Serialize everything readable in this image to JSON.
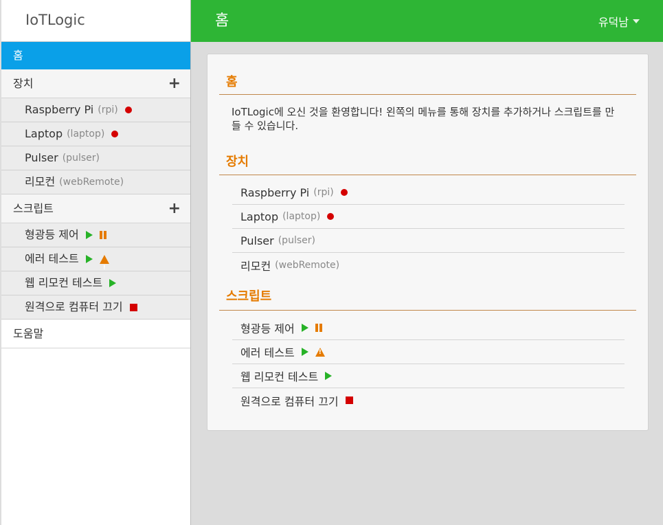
{
  "app": {
    "title": "IoTLogic"
  },
  "header": {
    "page_title": "홈",
    "user_name": "유덕남"
  },
  "sidebar": {
    "home_label": "홈",
    "devices_label": "장치",
    "devices": [
      {
        "name": "Raspberry Pi",
        "id": "(rpi)",
        "status": "offline"
      },
      {
        "name": "Laptop",
        "id": "(laptop)",
        "status": "offline"
      },
      {
        "name": "Pulser",
        "id": "(pulser)",
        "status": "none"
      },
      {
        "name": "리모컨",
        "id": "(webRemote)",
        "status": "none"
      }
    ],
    "scripts_label": "스크립트",
    "scripts": [
      {
        "name": "형광등 제어",
        "state": "running",
        "extra": "paused"
      },
      {
        "name": "에러 테스트",
        "state": "running",
        "extra": "warning"
      },
      {
        "name": "웹 리모컨 테스트",
        "state": "running",
        "extra": ""
      },
      {
        "name": "원격으로 컴퓨터 끄기",
        "state": "stopped",
        "extra": ""
      }
    ],
    "help_label": "도움말"
  },
  "main": {
    "home_heading": "홈",
    "welcome_text": "IoTLogic에 오신 것을 환영합니다!  왼쪽의 메뉴를 통해 장치를 추가하거나 스크립트를 만들 수 있습니다.",
    "devices_heading": "장치",
    "scripts_heading": "스크립트"
  },
  "colors": {
    "header_bg": "#2eb535",
    "active_nav": "#0aa0e8",
    "accent_orange": "#e57b00",
    "status_red": "#d40000",
    "run_green": "#27b227"
  },
  "icons": [
    "plus-icon",
    "caret-down-icon",
    "offline-dot-icon",
    "play-icon",
    "pause-icon",
    "warning-icon",
    "stop-icon"
  ]
}
